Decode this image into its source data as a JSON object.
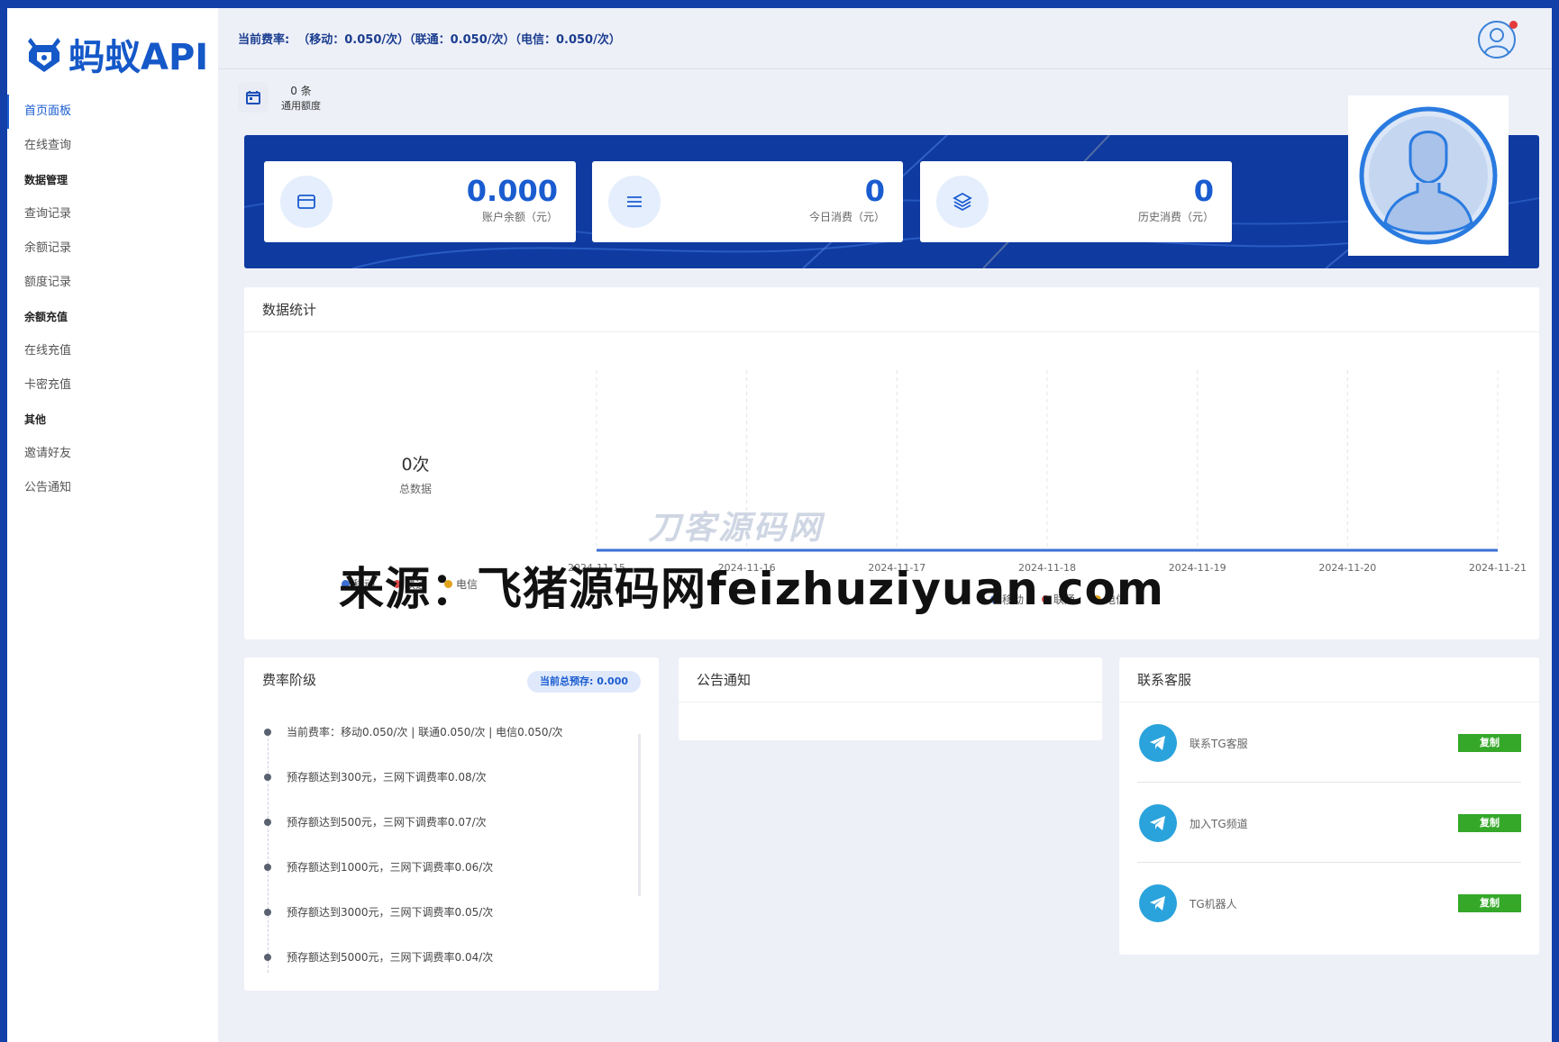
{
  "app": {
    "logo_text": "蚂蚁API"
  },
  "sidebar": {
    "items": [
      {
        "type": "item",
        "label": "首页面板",
        "active": true
      },
      {
        "type": "item",
        "label": "在线查询"
      },
      {
        "type": "group",
        "label": "数据管理"
      },
      {
        "type": "item",
        "label": "查询记录"
      },
      {
        "type": "item",
        "label": "余额记录"
      },
      {
        "type": "item",
        "label": "额度记录"
      },
      {
        "type": "group",
        "label": "余额充值"
      },
      {
        "type": "item",
        "label": "在线充值"
      },
      {
        "type": "item",
        "label": "卡密充值"
      },
      {
        "type": "group",
        "label": "其他"
      },
      {
        "type": "item",
        "label": "邀请好友"
      },
      {
        "type": "item",
        "label": "公告通知"
      }
    ]
  },
  "header": {
    "rate_text": "当前费率:  （移动：0.050/次）（联通：0.050/次）（电信：0.050/次）"
  },
  "quota": {
    "value": "0 条",
    "label": "通用额度"
  },
  "stats_cards": [
    {
      "value": "0.000",
      "label": "账户余额（元）",
      "icon": "card-icon"
    },
    {
      "value": "0",
      "label": "今日消费（元）",
      "icon": "list-icon"
    },
    {
      "value": "0",
      "label": "历史消费（元）",
      "icon": "layers-icon"
    }
  ],
  "data_stats": {
    "title": "数据统计",
    "total_value": "0次",
    "total_label": "总数据",
    "legend_left": [
      "移动",
      "联通",
      "电信"
    ],
    "legend_right": [
      "移动",
      "联通",
      "电信"
    ]
  },
  "chart_data": {
    "type": "line",
    "x": [
      "2024-11-15",
      "2024-11-16",
      "2024-11-17",
      "2024-11-18",
      "2024-11-19",
      "2024-11-20",
      "2024-11-21"
    ],
    "series": [
      {
        "name": "移动",
        "values": [
          0,
          0,
          0,
          0,
          0,
          0,
          0
        ]
      },
      {
        "name": "联通",
        "values": [
          0,
          0,
          0,
          0,
          0,
          0,
          0
        ]
      },
      {
        "name": "电信",
        "values": [
          0,
          0,
          0,
          0,
          0,
          0,
          0
        ]
      }
    ],
    "legend_colors": [
      "#3b6fd4",
      "#e04848",
      "#e0a31a"
    ],
    "grid": true,
    "legend": "bottom"
  },
  "rate_tiers": {
    "title": "费率阶级",
    "badge_label": "当前总预存:",
    "badge_value": "0.000",
    "items": [
      "当前费率：移动0.050/次 | 联通0.050/次 | 电信0.050/次",
      "预存额达到300元，三网下调费率0.08/次",
      "预存额达到500元，三网下调费率0.07/次",
      "预存额达到1000元，三网下调费率0.06/次",
      "预存额达到3000元，三网下调费率0.05/次",
      "预存额达到5000元，三网下调费率0.04/次"
    ]
  },
  "notice": {
    "title": "公告通知"
  },
  "contact": {
    "title": "联系客服",
    "copy_label": "复制",
    "items": [
      "联系TG客服",
      "加入TG频道",
      "TG机器人"
    ]
  },
  "watermarks": {
    "faint": "刀客源码网",
    "overlay": "来源：飞猪源码网feizhuziyuan.com"
  }
}
